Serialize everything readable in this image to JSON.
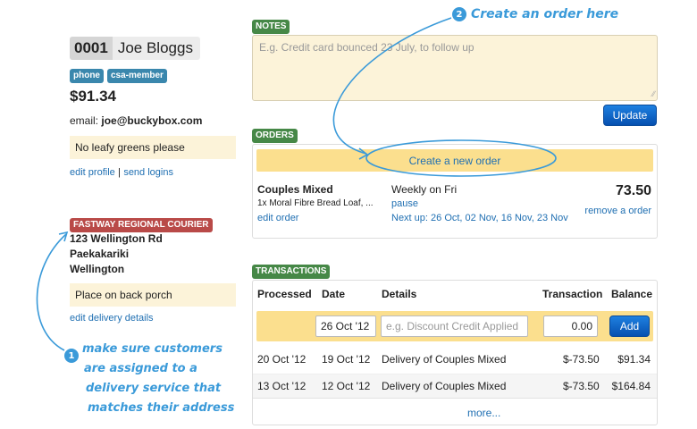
{
  "customer": {
    "id": "0001",
    "name": "Joe Bloggs",
    "tags": [
      "phone",
      "csa-member"
    ],
    "balance": "$91.34",
    "email_label": "email:",
    "email": "joe@buckybox.com",
    "note": "No leafy greens please",
    "links": {
      "edit_profile": "edit profile",
      "separator": "|",
      "send_logins": "send logins"
    }
  },
  "delivery": {
    "courier": "FASTWAY REGIONAL COURIER",
    "address_lines": [
      "123 Wellington Rd",
      "Paekakariki",
      "Wellington"
    ],
    "note": "Place on back porch",
    "edit_link": "edit delivery details"
  },
  "notes": {
    "label": "NOTES",
    "placeholder": "E.g. Credit card bounced 23 July, to follow up",
    "update_button": "Update"
  },
  "orders": {
    "label": "ORDERS",
    "create_button": "Create a new order",
    "items": [
      {
        "box": "Couples Mixed",
        "extras": "1x Moral Fibre Bread Loaf, ...",
        "edit": "edit order",
        "schedule": "Weekly on Fri",
        "pause": "pause",
        "next_up_label": "Next up:",
        "next_up_dates": "26 Oct, 02 Nov, 16 Nov, 23 Nov",
        "price": "73.50",
        "remove": "remove a order"
      }
    ]
  },
  "transactions": {
    "label": "TRANSACTIONS",
    "headers": [
      "Processed",
      "Date",
      "Details",
      "Transaction",
      "Balance"
    ],
    "form": {
      "date_value": "26 Oct '12",
      "details_placeholder": "e.g. Discount Credit Applied",
      "amount_value": "0.00",
      "add_button": "Add"
    },
    "rows": [
      {
        "processed": "20 Oct '12",
        "date": "19 Oct '12",
        "details": "Delivery of Couples Mixed",
        "transaction": "$-73.50",
        "balance": "$91.34"
      },
      {
        "processed": "13 Oct '12",
        "date": "12 Oct '12",
        "details": "Delivery of Couples Mixed",
        "transaction": "$-73.50",
        "balance": "$164.84"
      }
    ],
    "more": "more..."
  },
  "annotations": {
    "step1_number": "1",
    "step1_lines": [
      "make sure customers",
      "are assigned to a",
      "delivery service that",
      "matches their address"
    ],
    "step2_number": "2",
    "step2_text": "Create an order here"
  },
  "colors": {
    "accent_blue": "#1f6fb2",
    "annotation_blue": "#3a9ad9",
    "section_green": "#468847",
    "courier_red": "#b94a48",
    "tag_blue": "#3a87ad",
    "highlight_yellow": "#fbdf8e",
    "note_yellow": "#fcf3d9"
  }
}
